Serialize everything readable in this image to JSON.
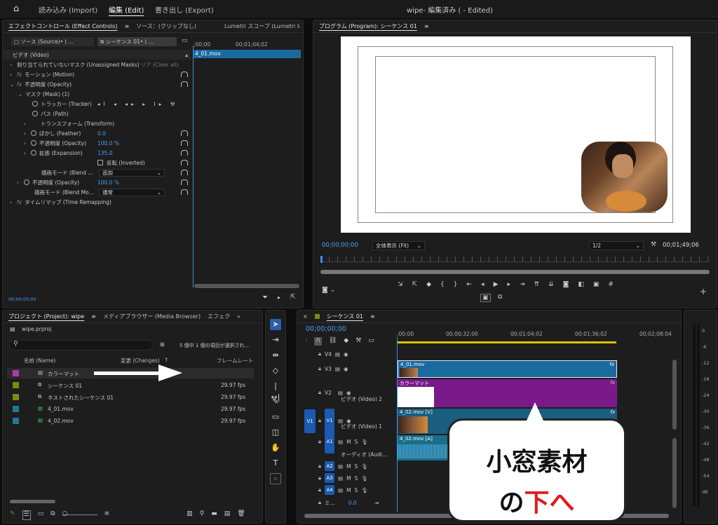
{
  "menubar": {
    "home_icon": "home-icon",
    "items": [
      "読み込み (Import)",
      "編集 (Edit)",
      "書き出し (Export)"
    ],
    "title": "wipe- 編集済み ( - Edited)"
  },
  "effect_controls": {
    "tabs": [
      "エフェクトコントロール (Effect Controls)",
      "ソース：(クリップなし)",
      "Lumetri スコープ (Lumetri ﾙ"
    ],
    "source_btn": "ソース (Source)• ( ...",
    "seq_btn": "シーケンス 01• ( ...",
    "ruler": {
      "t0": ";00;00",
      "t1": "00;01;04;02"
    },
    "clip_label": "4_01.mov",
    "video_label": "ビデオ (Video)",
    "mask_unassigned": "割り当てられていないマスク (Unassigned Masks)",
    "clear_all": "リア (Clear all)",
    "motion": "モーション (Motion)",
    "opacity": "不透明度 (Opacity)",
    "mask": "マスク (Mask) (1)",
    "tracker": "トラッカー (Tracker)",
    "path": "パス (Path)",
    "transform": "トランスフォーム (Transform)",
    "feather": "ぼかし (Feather)",
    "feather_val": "0.0",
    "mask_opacity": "不透明度 (Opacity)",
    "mask_opacity_val": "100.0 %",
    "expansion": "拡張 (Expansion)",
    "expansion_val": "135.0",
    "inverted": "反転 (Inverted)",
    "blend_label": "描画モード (Blend ...",
    "blend_value": "追加",
    "opacity2": "不透明度 (Opacity)",
    "opacity2_val": "100.0 %",
    "blend2_label": "描画モード (Blend Mo...",
    "blend2_value": "通常",
    "time_remap": "タイムリマップ (Time Remapping)",
    "timecode": "00;00;00;00"
  },
  "program": {
    "title": "プログラム (Program): シーケンス 01",
    "timecode": "00;00;00;00",
    "fit": "全体表示 (Fit)",
    "res": "1/2",
    "duration": "00;01;49;06"
  },
  "project": {
    "tabs": [
      "プロジェクト (Project): wipe",
      "メディアブラウザー (Media Browser)",
      "エフェク"
    ],
    "file": "wipe.prproj",
    "selected_info": "5 個中 1 個の項目が選択され...",
    "headers": {
      "name": "名前 (Name)",
      "changes": "変更 (Changes)",
      "rate": "フレームレート"
    },
    "items": [
      {
        "name": "カラーマット",
        "rate": "",
        "color": "#b036b0"
      },
      {
        "name": "シーケンス 01",
        "rate": "29.97 fps",
        "color": "#7d8a10"
      },
      {
        "name": "ネストされたシーケンス 01",
        "rate": "29.97 fps",
        "color": "#7d8a10"
      },
      {
        "name": "4_01.mov",
        "rate": "29.97 fps",
        "color": "#1f7a9a"
      },
      {
        "name": "4_02.mov",
        "rate": "29.97 fps",
        "color": "#1f7a9a"
      }
    ]
  },
  "timeline": {
    "title": "シーケンス 01",
    "timecode": "00;00;00;00",
    "ruler": [
      ";00;00",
      "00;00;32;00",
      "00;01;04;02",
      "00;01;36;02",
      "00;02;08;04"
    ],
    "tracks": {
      "v4": "V4",
      "v3": "V3",
      "v2": "V2",
      "v2_name": "ビデオ (Video) 2",
      "v1": "V1",
      "v1_name": "ビデオ (Video) 1",
      "a1": "A1",
      "a1_name": "オーディオ (Audi...",
      "a2": "A2",
      "a3": "A3",
      "a4": "A4",
      "mix": "ミ...",
      "mix_val": "0.0"
    },
    "clips": {
      "v3": "4_01.mov",
      "v2": "カラーマット",
      "v1": "4_02.mov [V]",
      "a1": "4_02.mov [A]"
    }
  },
  "meter": {
    "labels": [
      "0",
      "-6",
      "-12",
      "-18",
      "-24",
      "-30",
      "-36",
      "-42",
      "-48",
      "-54",
      "dB"
    ]
  },
  "callout": {
    "line1": "小窓素材",
    "line2a": "の",
    "line2b": "下へ"
  }
}
